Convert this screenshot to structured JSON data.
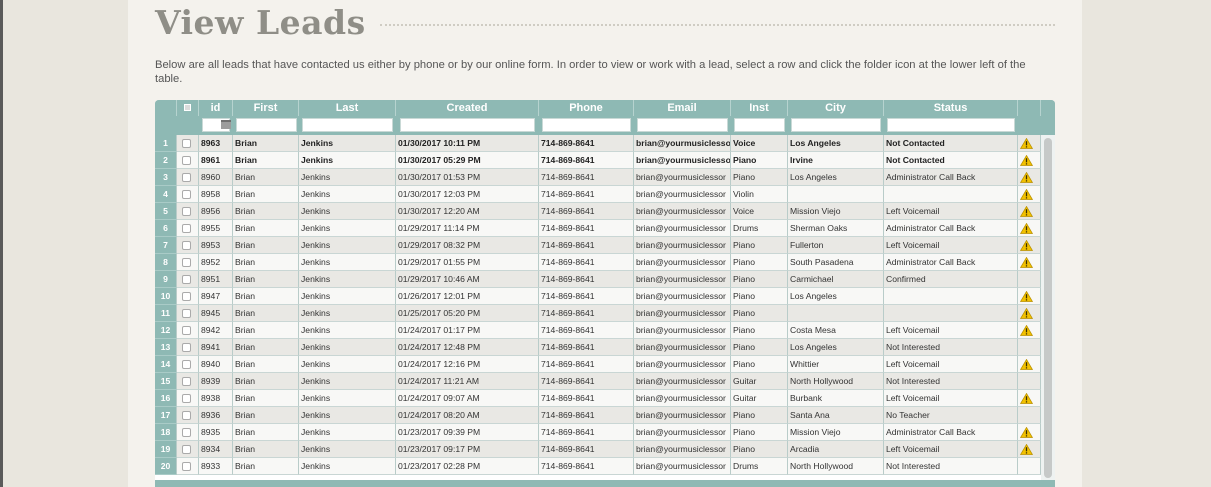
{
  "page": {
    "title": "View Leads",
    "intro": "Below are all leads that have contacted us either by phone or by our online form. In order to view or work with a lead, select a row and click the folder icon at the lower left of the table."
  },
  "grid": {
    "columns": {
      "id": "id",
      "first": "First",
      "last": "Last",
      "created": "Created",
      "phone": "Phone",
      "email": "Email",
      "inst": "Inst",
      "city": "City",
      "status": "Status"
    },
    "rows": [
      {
        "n": "1",
        "id": "8963",
        "first": "Brian",
        "last": "Jenkins",
        "created": "01/30/2017 10:11 PM",
        "phone": "714-869-8641",
        "email": "brian@yourmusiclesso",
        "inst": "Voice",
        "city": "Los Angeles",
        "status": "Not Contacted",
        "warn": true,
        "bold": true
      },
      {
        "n": "2",
        "id": "8961",
        "first": "Brian",
        "last": "Jenkins",
        "created": "01/30/2017 05:29 PM",
        "phone": "714-869-8641",
        "email": "brian@yourmusiclesso",
        "inst": "Piano",
        "city": "Irvine",
        "status": "Not Contacted",
        "warn": true,
        "bold": true
      },
      {
        "n": "3",
        "id": "8960",
        "first": "Brian",
        "last": "Jenkins",
        "created": "01/30/2017 01:53 PM",
        "phone": "714-869-8641",
        "email": "brian@yourmusiclessor",
        "inst": "Piano",
        "city": "Los Angeles",
        "status": "Administrator Call Back",
        "warn": true,
        "bold": false
      },
      {
        "n": "4",
        "id": "8958",
        "first": "Brian",
        "last": "Jenkins",
        "created": "01/30/2017 12:03 PM",
        "phone": "714-869-8641",
        "email": "brian@yourmusiclessor",
        "inst": "Violin",
        "city": "",
        "status": "",
        "warn": true,
        "bold": false
      },
      {
        "n": "5",
        "id": "8956",
        "first": "Brian",
        "last": "Jenkins",
        "created": "01/30/2017 12:20 AM",
        "phone": "714-869-8641",
        "email": "brian@yourmusiclessor",
        "inst": "Voice",
        "city": "Mission Viejo",
        "status": "Left Voicemail",
        "warn": true,
        "bold": false
      },
      {
        "n": "6",
        "id": "8955",
        "first": "Brian",
        "last": "Jenkins",
        "created": "01/29/2017 11:14 PM",
        "phone": "714-869-8641",
        "email": "brian@yourmusiclessor",
        "inst": "Drums",
        "city": "Sherman Oaks",
        "status": "Administrator Call Back",
        "warn": true,
        "bold": false
      },
      {
        "n": "7",
        "id": "8953",
        "first": "Brian",
        "last": "Jenkins",
        "created": "01/29/2017 08:32 PM",
        "phone": "714-869-8641",
        "email": "brian@yourmusiclessor",
        "inst": "Piano",
        "city": "Fullerton",
        "status": "Left Voicemail",
        "warn": true,
        "bold": false
      },
      {
        "n": "8",
        "id": "8952",
        "first": "Brian",
        "last": "Jenkins",
        "created": "01/29/2017 01:55 PM",
        "phone": "714-869-8641",
        "email": "brian@yourmusiclessor",
        "inst": "Piano",
        "city": "South Pasadena",
        "status": "Administrator Call Back",
        "warn": true,
        "bold": false
      },
      {
        "n": "9",
        "id": "8951",
        "first": "Brian",
        "last": "Jenkins",
        "created": "01/29/2017 10:46 AM",
        "phone": "714-869-8641",
        "email": "brian@yourmusiclessor",
        "inst": "Piano",
        "city": "Carmichael",
        "status": "Confirmed",
        "warn": false,
        "bold": false
      },
      {
        "n": "10",
        "id": "8947",
        "first": "Brian",
        "last": "Jenkins",
        "created": "01/26/2017 12:01 PM",
        "phone": "714-869-8641",
        "email": "brian@yourmusiclessor",
        "inst": "Piano",
        "city": "Los Angeles",
        "status": "",
        "warn": true,
        "bold": false
      },
      {
        "n": "11",
        "id": "8945",
        "first": "Brian",
        "last": "Jenkins",
        "created": "01/25/2017 05:20 PM",
        "phone": "714-869-8641",
        "email": "brian@yourmusiclessor",
        "inst": "Piano",
        "city": "",
        "status": "",
        "warn": true,
        "bold": false
      },
      {
        "n": "12",
        "id": "8942",
        "first": "Brian",
        "last": "Jenkins",
        "created": "01/24/2017 01:17 PM",
        "phone": "714-869-8641",
        "email": "brian@yourmusiclessor",
        "inst": "Piano",
        "city": "Costa Mesa",
        "status": "Left Voicemail",
        "warn": true,
        "bold": false
      },
      {
        "n": "13",
        "id": "8941",
        "first": "Brian",
        "last": "Jenkins",
        "created": "01/24/2017 12:48 PM",
        "phone": "714-869-8641",
        "email": "brian@yourmusiclessor",
        "inst": "Piano",
        "city": "Los Angeles",
        "status": "Not Interested",
        "warn": false,
        "bold": false
      },
      {
        "n": "14",
        "id": "8940",
        "first": "Brian",
        "last": "Jenkins",
        "created": "01/24/2017 12:16 PM",
        "phone": "714-869-8641",
        "email": "brian@yourmusiclessor",
        "inst": "Piano",
        "city": "Whittier",
        "status": "Left Voicemail",
        "warn": true,
        "bold": false
      },
      {
        "n": "15",
        "id": "8939",
        "first": "Brian",
        "last": "Jenkins",
        "created": "01/24/2017 11:21 AM",
        "phone": "714-869-8641",
        "email": "brian@yourmusiclessor",
        "inst": "Guitar",
        "city": "North Hollywood",
        "status": "Not Interested",
        "warn": false,
        "bold": false
      },
      {
        "n": "16",
        "id": "8938",
        "first": "Brian",
        "last": "Jenkins",
        "created": "01/24/2017 09:07 AM",
        "phone": "714-869-8641",
        "email": "brian@yourmusiclessor",
        "inst": "Guitar",
        "city": "Burbank",
        "status": "Left Voicemail",
        "warn": true,
        "bold": false
      },
      {
        "n": "17",
        "id": "8936",
        "first": "Brian",
        "last": "Jenkins",
        "created": "01/24/2017 08:20 AM",
        "phone": "714-869-8641",
        "email": "brian@yourmusiclessor",
        "inst": "Piano",
        "city": "Santa Ana",
        "status": "No Teacher",
        "warn": false,
        "bold": false
      },
      {
        "n": "18",
        "id": "8935",
        "first": "Brian",
        "last": "Jenkins",
        "created": "01/23/2017 09:39 PM",
        "phone": "714-869-8641",
        "email": "brian@yourmusiclessor",
        "inst": "Piano",
        "city": "Mission Viejo",
        "status": "Administrator Call Back",
        "warn": true,
        "bold": false
      },
      {
        "n": "19",
        "id": "8934",
        "first": "Brian",
        "last": "Jenkins",
        "created": "01/23/2017 09:17 PM",
        "phone": "714-869-8641",
        "email": "brian@yourmusiclessor",
        "inst": "Piano",
        "city": "Arcadia",
        "status": "Left Voicemail",
        "warn": true,
        "bold": false
      },
      {
        "n": "20",
        "id": "8933",
        "first": "Brian",
        "last": "Jenkins",
        "created": "01/23/2017 02:28 PM",
        "phone": "714-869-8641",
        "email": "brian@yourmusiclessor",
        "inst": "Drums",
        "city": "North Hollywood",
        "status": "Not Interested",
        "warn": false,
        "bold": false
      }
    ]
  },
  "colors": {
    "accent": "#8eb9b4",
    "warning": "#f2c100",
    "title": "#8f8e87"
  },
  "icons": {
    "warn": "warning-icon",
    "calendar": "calendar-icon",
    "select_all": "select-all-icon"
  }
}
